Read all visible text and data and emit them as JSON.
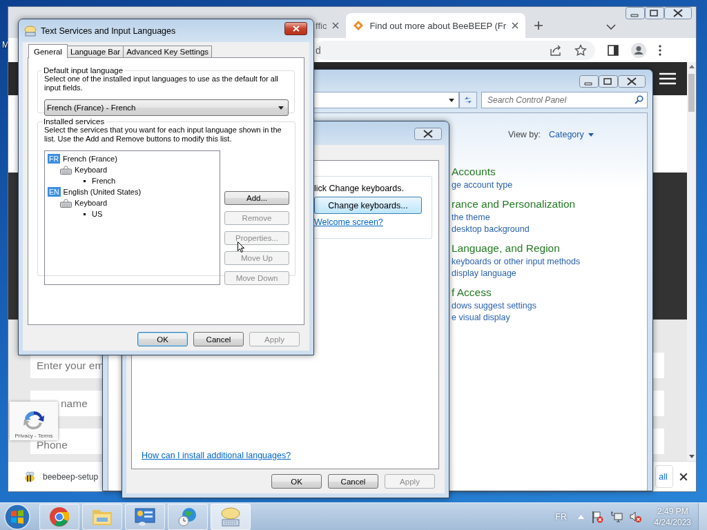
{
  "desktop": {
    "icon_label": "M"
  },
  "browser": {
    "tabs": [
      {
        "title": "ffic",
        "selected": false
      },
      {
        "title": "Find out more about BeeBEEP (Fr",
        "selected": true
      }
    ],
    "address": "d",
    "form_fields": [
      {
        "placeholder": "Enter your em"
      },
      {
        "placeholder": "name"
      },
      {
        "placeholder": "Phone"
      }
    ],
    "recaptcha": "Privacy - Terms",
    "download": {
      "file": "beebeep-setup",
      "button": "all"
    }
  },
  "control_panel": {
    "search": {
      "placeholder": "Search Control Panel"
    },
    "view_by": {
      "label": "View by:",
      "value": "Category"
    },
    "categories": [
      {
        "title": "Accounts",
        "links": [
          "ge account type"
        ]
      },
      {
        "title": "rance and Personalization",
        "links": [
          "the theme",
          "desktop background"
        ]
      },
      {
        "title": "Language, and Region",
        "links": [
          "keyboards or other input methods",
          "display language"
        ]
      },
      {
        "title": "f Access",
        "links": [
          "dows suggest settings",
          "e visual display"
        ]
      }
    ]
  },
  "region_dialog": {
    "keyboards": {
      "text": "lick Change keyboards.",
      "button": "Change keyboards...",
      "link": "Welcome screen?"
    },
    "help_link": "How can I install additional languages?",
    "buttons": [
      {
        "label": "OK",
        "disabled": false
      },
      {
        "label": "Cancel",
        "disabled": false
      },
      {
        "label": "Apply",
        "disabled": true
      }
    ]
  },
  "text_services": {
    "title": "Text Services and Input Languages",
    "tabs": [
      {
        "label": "General",
        "selected": true
      },
      {
        "label": "Language Bar",
        "selected": false
      },
      {
        "label": "Advanced Key Settings",
        "selected": false
      }
    ],
    "default_language": {
      "title": "Default input language",
      "description": "Select one of the installed input languages to use as the default for all input fields.",
      "value": "French (France) - French"
    },
    "installed_services": {
      "title": "Installed services",
      "description": "Select the services that you want for each input language shown in the list. Use the Add and Remove buttons to modify this list.",
      "tree": [
        {
          "kind": "language",
          "badge": "FR",
          "label": "French (France)",
          "children": [
            {
              "kind": "service",
              "label": "Keyboard",
              "children": [
                {
                  "kind": "layout",
                  "label": "French"
                }
              ]
            }
          ]
        },
        {
          "kind": "language",
          "badge": "EN",
          "label": "English (United States)",
          "children": [
            {
              "kind": "service",
              "label": "Keyboard",
              "children": [
                {
                  "kind": "layout",
                  "label": "US"
                }
              ]
            }
          ]
        }
      ],
      "buttons": [
        {
          "label": "Add...",
          "disabled": false
        },
        {
          "label": "Remove",
          "disabled": true
        },
        {
          "label": "Properties...",
          "disabled": true
        },
        {
          "label": "Move Up",
          "disabled": true
        },
        {
          "label": "Move Down",
          "disabled": true
        }
      ]
    },
    "buttons": [
      {
        "label": "OK",
        "disabled": false
      },
      {
        "label": "Cancel",
        "disabled": false
      },
      {
        "label": "Apply",
        "disabled": true
      }
    ]
  },
  "taskbar": {
    "apps": [
      {
        "kind": "chrome",
        "selected": false
      },
      {
        "kind": "explorer",
        "selected": false
      },
      {
        "kind": "control_panel",
        "selected": false
      },
      {
        "kind": "region",
        "selected": false
      },
      {
        "kind": "text_services",
        "selected": true
      }
    ],
    "language": "FR",
    "time": "2:49 PM",
    "date": "4/24/2023"
  }
}
